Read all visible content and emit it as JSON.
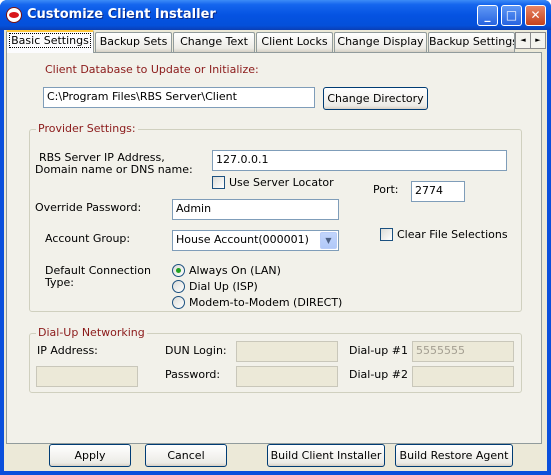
{
  "window": {
    "title": "Customize Client Installer",
    "controls": {
      "minimize": "_",
      "maximize": "□",
      "close": "✕"
    }
  },
  "tabs": [
    {
      "label": "Basic Settings",
      "active": true
    },
    {
      "label": "Backup Sets"
    },
    {
      "label": "Change Text"
    },
    {
      "label": "Client Locks"
    },
    {
      "label": "Change Display"
    },
    {
      "label": "Backup Settings"
    }
  ],
  "tab_scroll": {
    "left": "◄",
    "right": "►"
  },
  "database": {
    "label": "Client Database to Update or Initialize:",
    "path": "C:\\Program Files\\RBS Server\\Client",
    "change_directory": "Change Directory"
  },
  "provider": {
    "group_title": "Provider Settings:",
    "ip_label_line1": "RBS Server IP Address,",
    "ip_label_line2": "Domain name or DNS name:",
    "ip_value": "127.0.0.1",
    "use_locator_label": "Use Server Locator",
    "port_label": "Port:",
    "port_value": "2774",
    "override_label": "Override Password:",
    "override_value": "Admin",
    "account_group_label": "Account Group:",
    "account_group_value": "House Account(000001)",
    "clear_file_label": "Clear File Selections",
    "conn_type_line1": "Default Connection",
    "conn_type_line2": "Type:",
    "conn_options": [
      {
        "label": "Always On (LAN)",
        "selected": true
      },
      {
        "label": "Dial Up (ISP)",
        "selected": false
      },
      {
        "label": "Modem-to-Modem (DIRECT)",
        "selected": false
      }
    ]
  },
  "dialup": {
    "group_title": "Dial-Up Networking",
    "ip_label": "IP Address:",
    "dun_login_label": "DUN Login:",
    "password_label": "Password:",
    "dialup1_label": "Dial-up #1",
    "dialup1_value": "5555555",
    "dialup2_label": "Dial-up #2"
  },
  "buttons": {
    "apply": "Apply",
    "cancel": "Cancel",
    "build_client": "Build Client Installer",
    "build_restore": "Build Restore Agent"
  }
}
